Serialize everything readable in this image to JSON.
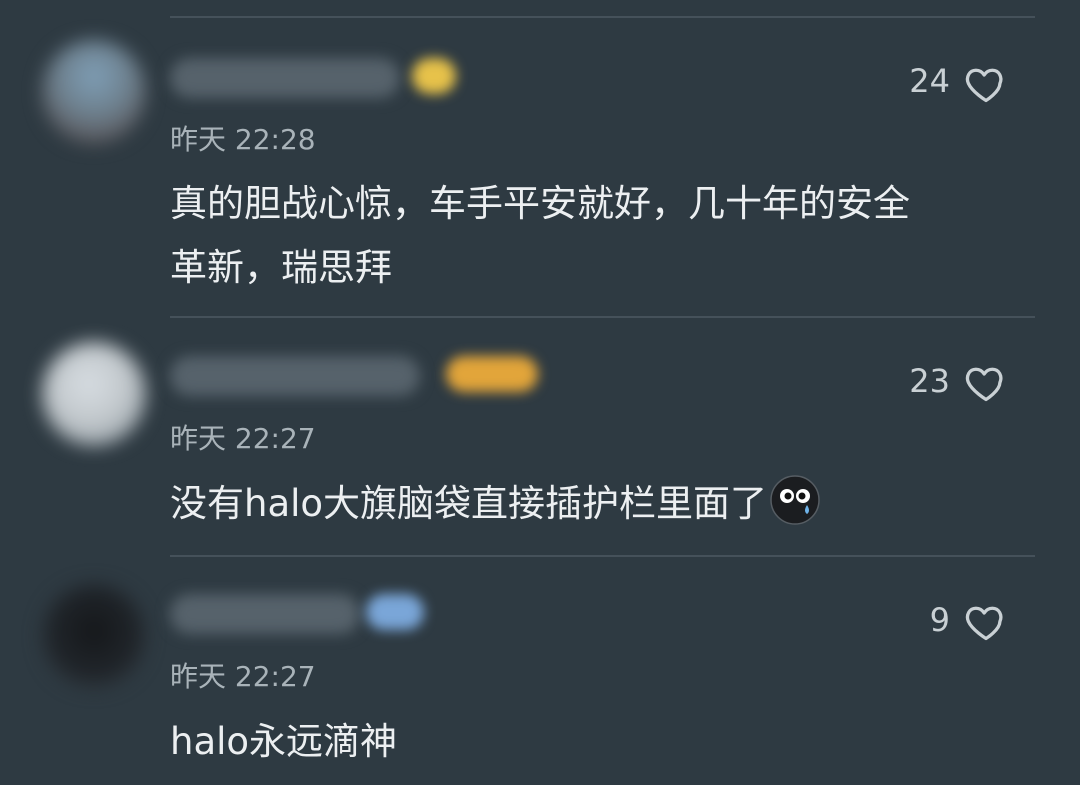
{
  "comments": [
    {
      "time": "昨天 22:28",
      "likes": "24",
      "text_lines": [
        "真的胆战心惊，车手平安就好，几十年的安全",
        "革新，瑞思拜"
      ]
    },
    {
      "time": "昨天 22:27",
      "likes": "23",
      "text": "没有halo大旗脑袋直接插护栏里面了",
      "emoji": "crying-face-emoji"
    },
    {
      "time": "昨天 22:27",
      "likes": "9",
      "text": "halo永远滴神"
    }
  ],
  "icons": {
    "like": "heart-outline-icon"
  },
  "colors": {
    "background": "#2e3a42",
    "divider": "#45515a",
    "text": "#eceff1",
    "secondary_text": "#a9b3b9"
  }
}
